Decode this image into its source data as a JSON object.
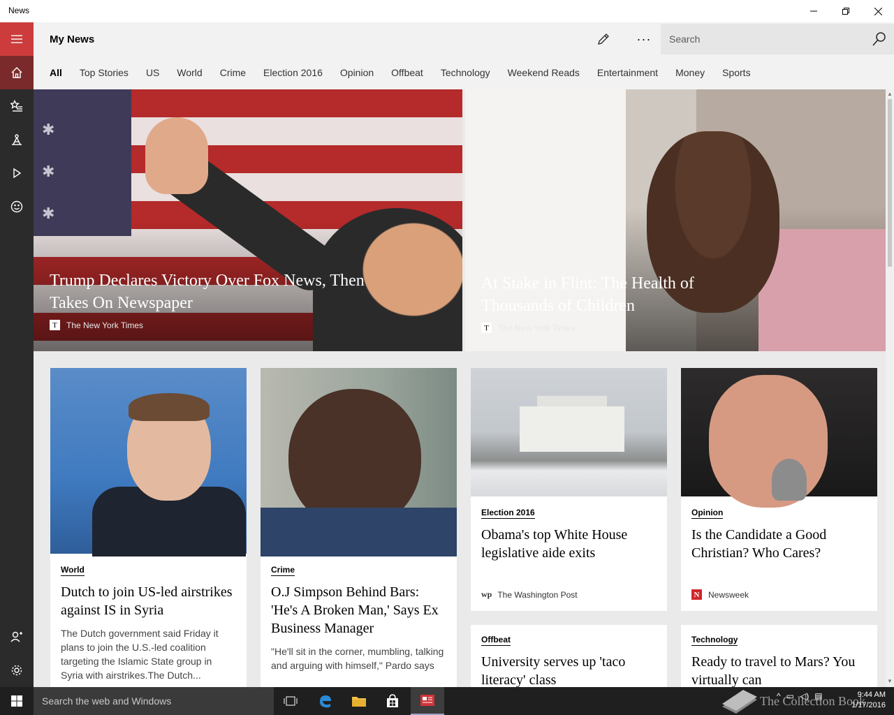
{
  "window": {
    "title": "News",
    "minimize_icon": "minimize-icon",
    "maximize_icon": "restore-icon",
    "close_icon": "close-icon"
  },
  "header": {
    "title": "My News",
    "search_placeholder": "Search",
    "tabs": [
      "All",
      "Top Stories",
      "US",
      "World",
      "Crime",
      "Election 2016",
      "Opinion",
      "Offbeat",
      "Technology",
      "Weekend Reads",
      "Entertainment",
      "Money",
      "Sports"
    ],
    "active_tab": "All"
  },
  "rail": {
    "accent": "#cc3c3c",
    "items": [
      "hamburger-icon",
      "home-icon",
      "favorites-icon",
      "local-icon",
      "video-icon",
      "emoji-icon",
      "account-icon",
      "settings-icon"
    ]
  },
  "heroes": [
    {
      "title": "Trump Declares Victory Over Fox News, Then Takes On Newspaper",
      "source": "The New York Times",
      "source_logo": "T"
    },
    {
      "title": "At Stake in Flint: The Health of Thousands of Children",
      "source": "The New York Times",
      "source_logo": "T"
    }
  ],
  "cards": [
    {
      "category": "World",
      "title": "Dutch to join US-led airstrikes against IS in Syria",
      "description": "The Dutch government said Friday it plans to join the U.S.-led coalition targeting the Islamic State group in Syria with airstrikes.The Dutch..."
    },
    {
      "category": "Crime",
      "title": "O.J Simpson Behind Bars: 'He's A Broken Man,' Says Ex Business Manager",
      "description": "\"He'll sit in the corner, mumbling, talking and arguing with himself,\" Pardo says"
    },
    {
      "category": "Election 2016",
      "title": "Obama's top White House legislative aide exits",
      "source": "The Washington Post",
      "source_logo": "wp"
    },
    {
      "category": "Opinion",
      "title": "Is the Candidate a Good Christian? Who Cares?",
      "source": "Newsweek",
      "source_logo": "N"
    },
    {
      "category": "Offbeat",
      "title": "University serves up 'taco literacy' class"
    },
    {
      "category": "Technology",
      "title": "Ready to travel to Mars? You virtually can"
    }
  ],
  "taskbar": {
    "search_placeholder": "Search the web and Windows",
    "watermark": "The Collection Book",
    "time": "9:44 AM",
    "date": "1/17/2016"
  }
}
